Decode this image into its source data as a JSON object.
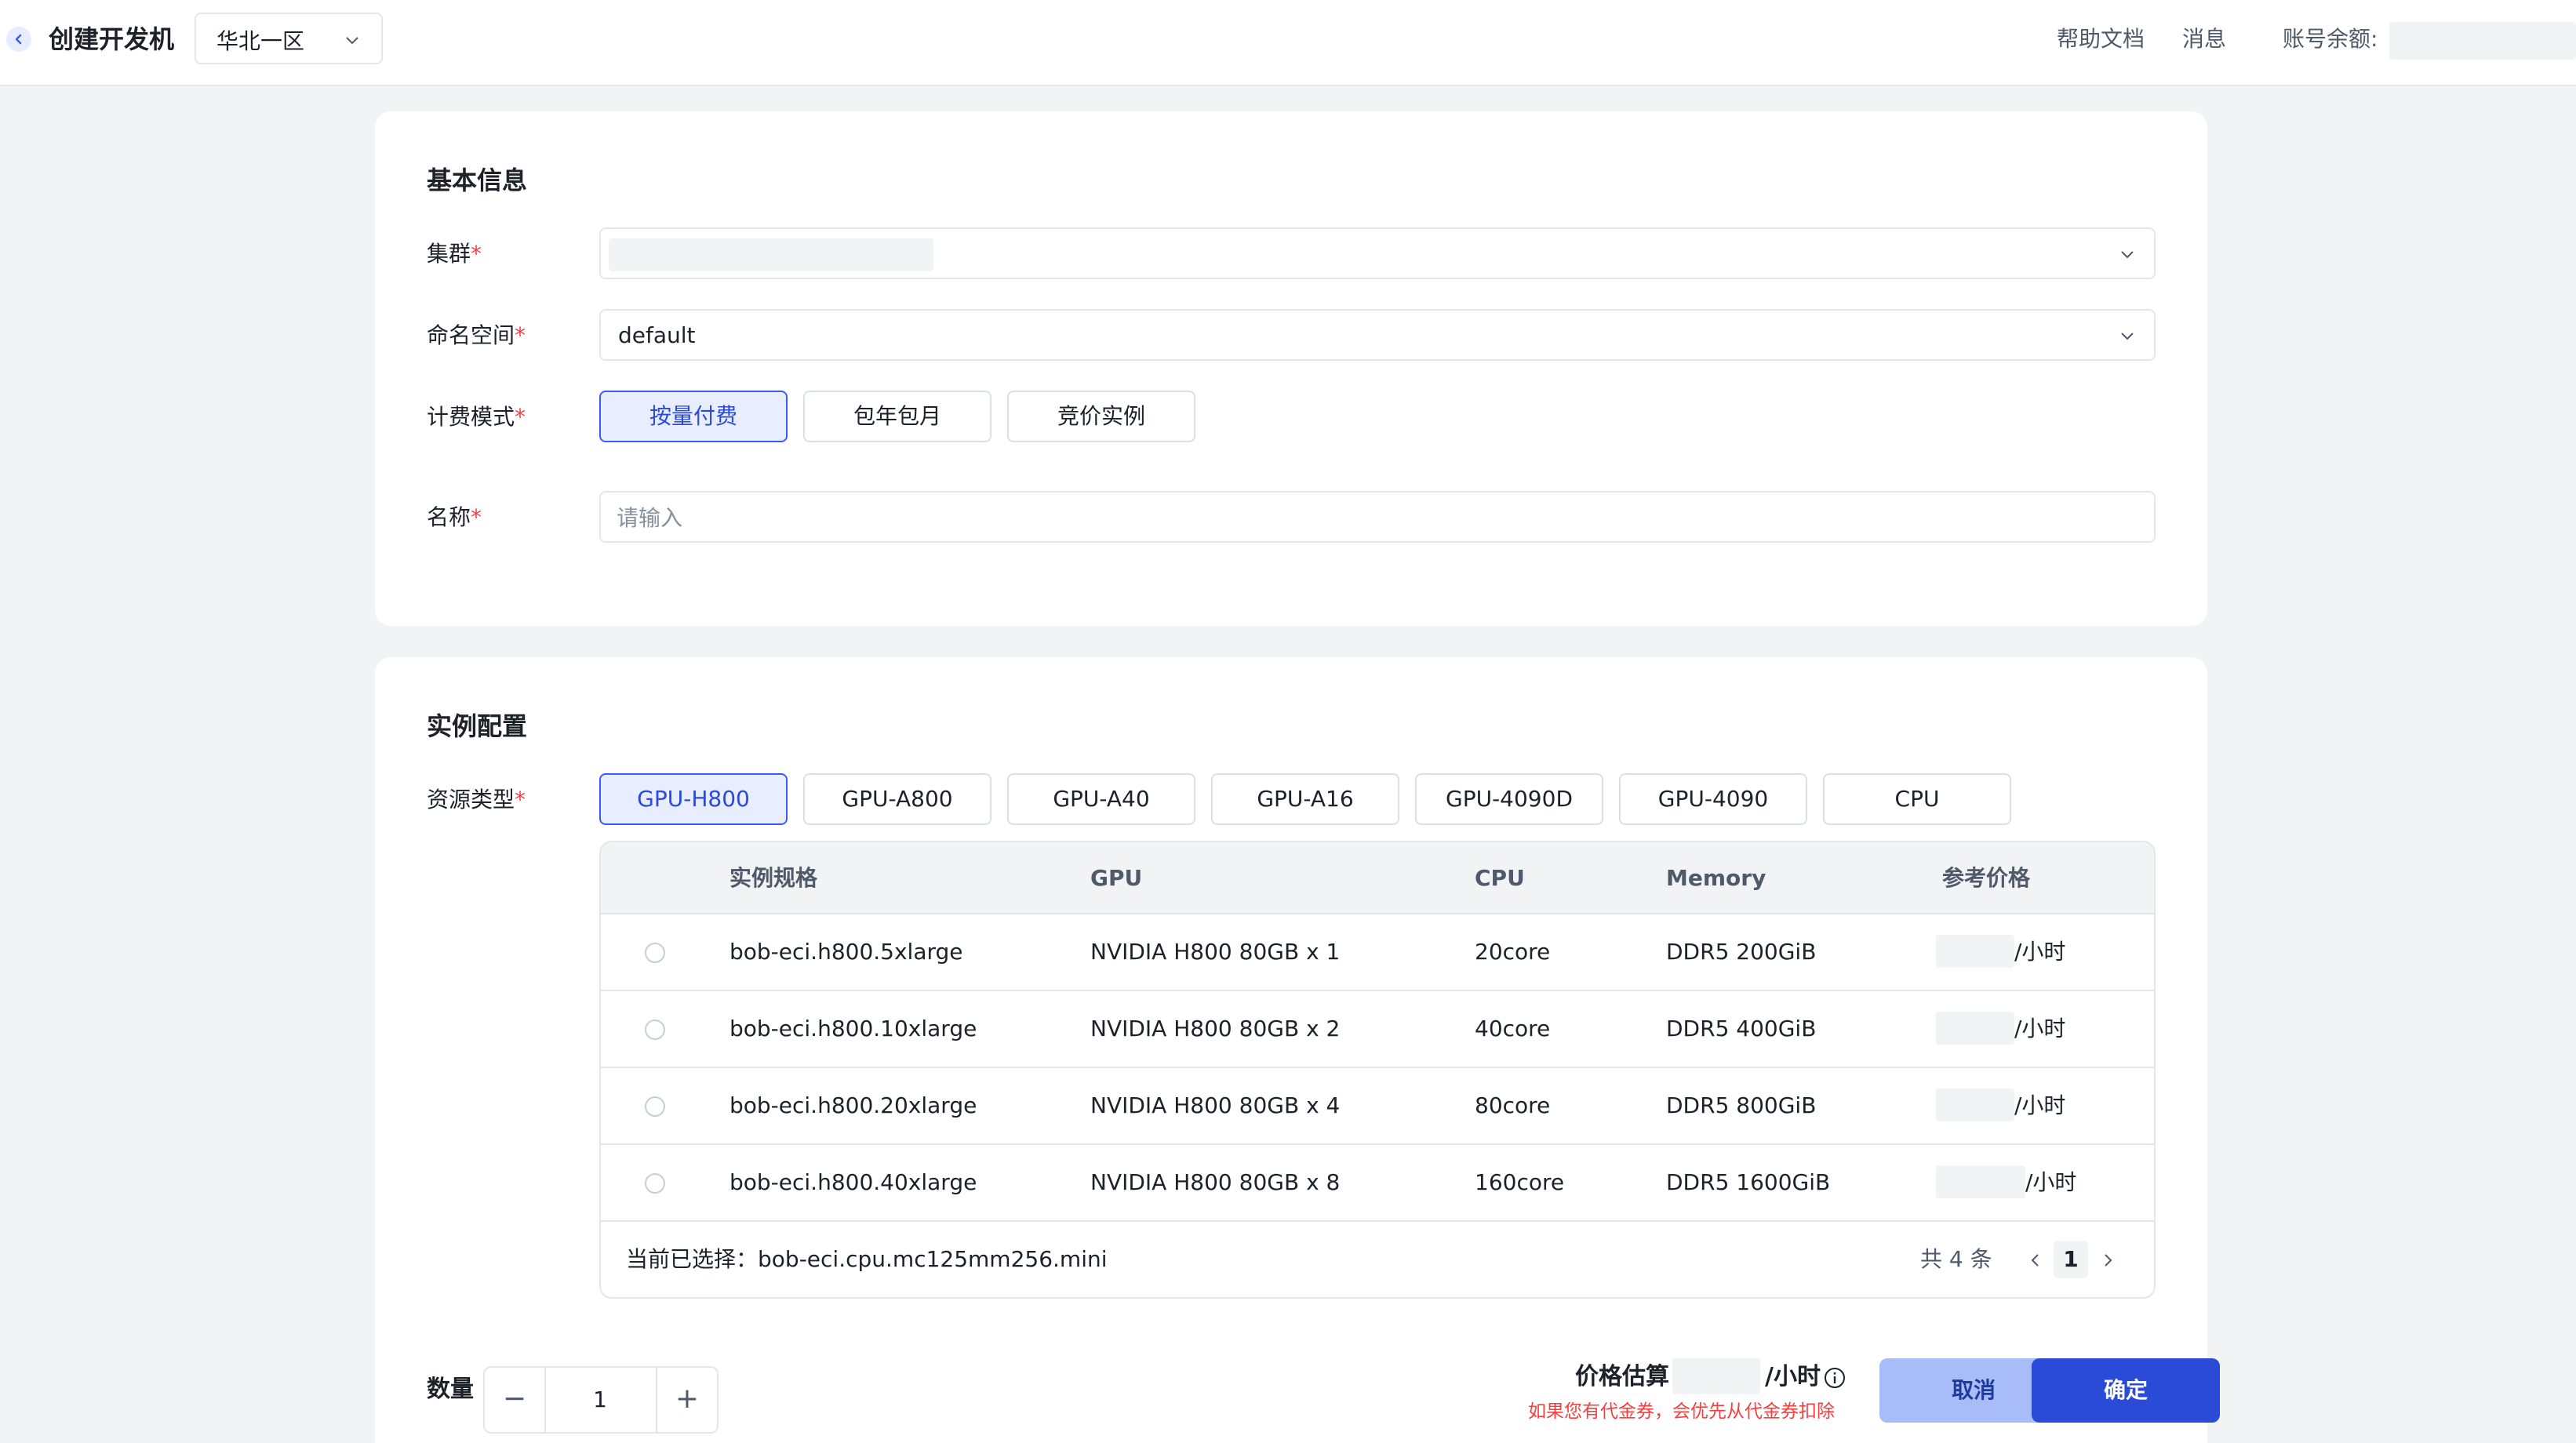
{
  "header": {
    "title": "创建开发机",
    "region": "华北一区",
    "links": {
      "help": "帮助文档",
      "messages": "消息",
      "balance_label": "账号余额:"
    }
  },
  "basic_info": {
    "title": "基本信息",
    "cluster_label": "集群",
    "namespace_label": "命名空间",
    "namespace_value": "default",
    "billing_label": "计费模式",
    "billing_modes": [
      "按量付费",
      "包年包月",
      "竞价实例"
    ],
    "billing_selected": "按量付费",
    "name_label": "名称",
    "name_placeholder": "请输入"
  },
  "instance_config": {
    "title": "实例配置",
    "resource_label": "资源类型",
    "resource_types": [
      "GPU-H800",
      "GPU-A800",
      "GPU-A40",
      "GPU-A16",
      "GPU-4090D",
      "GPU-4090",
      "CPU"
    ],
    "resource_selected": "GPU-H800",
    "table": {
      "headers": [
        "实例规格",
        "GPU",
        "CPU",
        "Memory",
        "参考价格"
      ],
      "rows": [
        {
          "spec": "bob-eci.h800.5xlarge",
          "gpu": "NVIDIA H800 80GB x 1",
          "cpu": "20core",
          "memory": "DDR5 200GiB",
          "price_unit": "/小时"
        },
        {
          "spec": "bob-eci.h800.10xlarge",
          "gpu": "NVIDIA H800 80GB x 2",
          "cpu": "40core",
          "memory": "DDR5 400GiB",
          "price_unit": "/小时"
        },
        {
          "spec": "bob-eci.h800.20xlarge",
          "gpu": "NVIDIA H800 80GB x 4",
          "cpu": "80core",
          "memory": "DDR5 800GiB",
          "price_unit": "/小时"
        },
        {
          "spec": "bob-eci.h800.40xlarge",
          "gpu": "NVIDIA H800 80GB x 8",
          "cpu": "160core",
          "memory": "DDR5 1600GiB",
          "price_unit": "/小时"
        }
      ],
      "current_selection_label": "当前已选择：",
      "current_selection_value": "bob-eci.cpu.mc125mm256.mini",
      "total": "共 4 条",
      "page": "1"
    }
  },
  "footer": {
    "quantity_label": "数量",
    "quantity_value": "1",
    "minus": "−",
    "plus": "+",
    "price_label": "价格估算",
    "price_unit": "/小时",
    "coupon_note": "如果您有代金券，会优先从代金券扣除",
    "cancel": "取消",
    "confirm": "确定"
  },
  "colors": {
    "primary": "#2a4ad8",
    "primary_light": "#e8eeff",
    "required": "#f53f3f",
    "page_bg": "#f2f3f5"
  }
}
